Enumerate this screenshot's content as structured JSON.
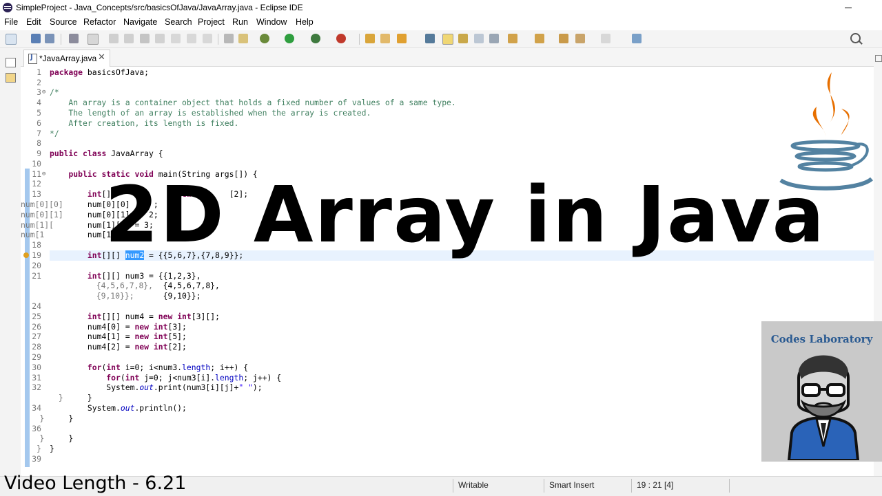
{
  "window": {
    "title": "SimpleProject - Java_Concepts/src/basicsOfJava/JavaArray.java - Eclipse IDE"
  },
  "menu": [
    "File",
    "Edit",
    "Source",
    "Refactor",
    "Navigate",
    "Search",
    "Project",
    "Run",
    "Window",
    "Help"
  ],
  "tab": {
    "label": "*JavaArray.java",
    "close": "✕"
  },
  "overlay": {
    "title": "2D Array in Java",
    "video_length": "Video Length - 6.21"
  },
  "badge": {
    "title": "Codes Laboratory"
  },
  "status": {
    "writable": "Writable",
    "insert_mode": "Smart Insert",
    "position": "19 : 21 [4]"
  },
  "colors": {
    "keyword": "#7f0055",
    "comment": "#3f7f5f",
    "field": "#0000c0",
    "selection": "#3399ff",
    "java_orange": "#e76f00",
    "java_blue": "#5382a1"
  },
  "code": {
    "l1": "1",
    "l2": "2",
    "l3": "3",
    "l4": "4",
    "l5": "5",
    "l6": "6",
    "l7": "7",
    "l8": "8",
    "l9": "9",
    "l10": "10",
    "l11": "11",
    "l12": "12",
    "l13": "13",
    "l14": "num[0][0]",
    "l15": "num[0][1]",
    "l16": "num[1][",
    "l17": "num[1",
    "l18": "18",
    "l19": "19",
    "l20": "20",
    "l21": "21",
    "l22": "                {4,5,6,7,8},",
    "l23": "                {9,10}};",
    "l24": "24",
    "l25": "25",
    "l26": "26",
    "l27": "27",
    "l28": "28",
    "l29": "29",
    "l30": "30",
    "l31": "31",
    "l32": "32",
    "l33": "        }",
    "l34": "34",
    "l35": "    }",
    "l36": "36",
    "l37": "    }",
    "l38": "}",
    "l39": "39",
    "kw_package": "package",
    "pkg_name": " basicsOfJava;",
    "cm_open": "/*",
    "cm_1": "    An array is a container object that holds a fixed number of values of a same type.",
    "cm_2": "    The length of an array is established when the array is created.",
    "cm_3": "    After creation, its length is fixed.",
    "cm_close": "*/",
    "kw_public": "public",
    "kw_class": "class",
    "class_name": " JavaArray {",
    "kw_static": "static",
    "kw_void": "void",
    "main_sig": " main(String args[]) {",
    "kw_int": "int",
    "kw_new": "new",
    "l13_tail": "[2];",
    "l14_tail": ";",
    "l15_tail": "2;",
    "l16_tail": "= 3;",
    "arr": "[][] ",
    "num2": "num2",
    "l19_tail": " = {{5,6,7},{7,8,9}};",
    "l21_tail": "num3 = {{1,2,3},",
    "l25_mid": "num4 = ",
    "l25_tail": "[3][];",
    "l26_a": "    num4[0] = ",
    "l26_b": "[3];",
    "l27_a": "    num4[1] = ",
    "l27_b": "[5];",
    "l28_a": "    num4[2] = ",
    "l28_b": "[2];",
    "kw_for": "for",
    "l30_a": "(",
    "l30_b": " i=0; i<num3.",
    "length": "length",
    "l30_c": "; i++) {",
    "l31_b": " j=0; j<num3[i].",
    "l31_c": "; j++) {",
    "l32_a": "            System.",
    "out": "out",
    "l32_b": ".print(num3[i][j]+",
    "l32_str": "\" \"",
    "l32_c": ");",
    "l34_a": "        System.",
    "l34_b": ".println();"
  }
}
